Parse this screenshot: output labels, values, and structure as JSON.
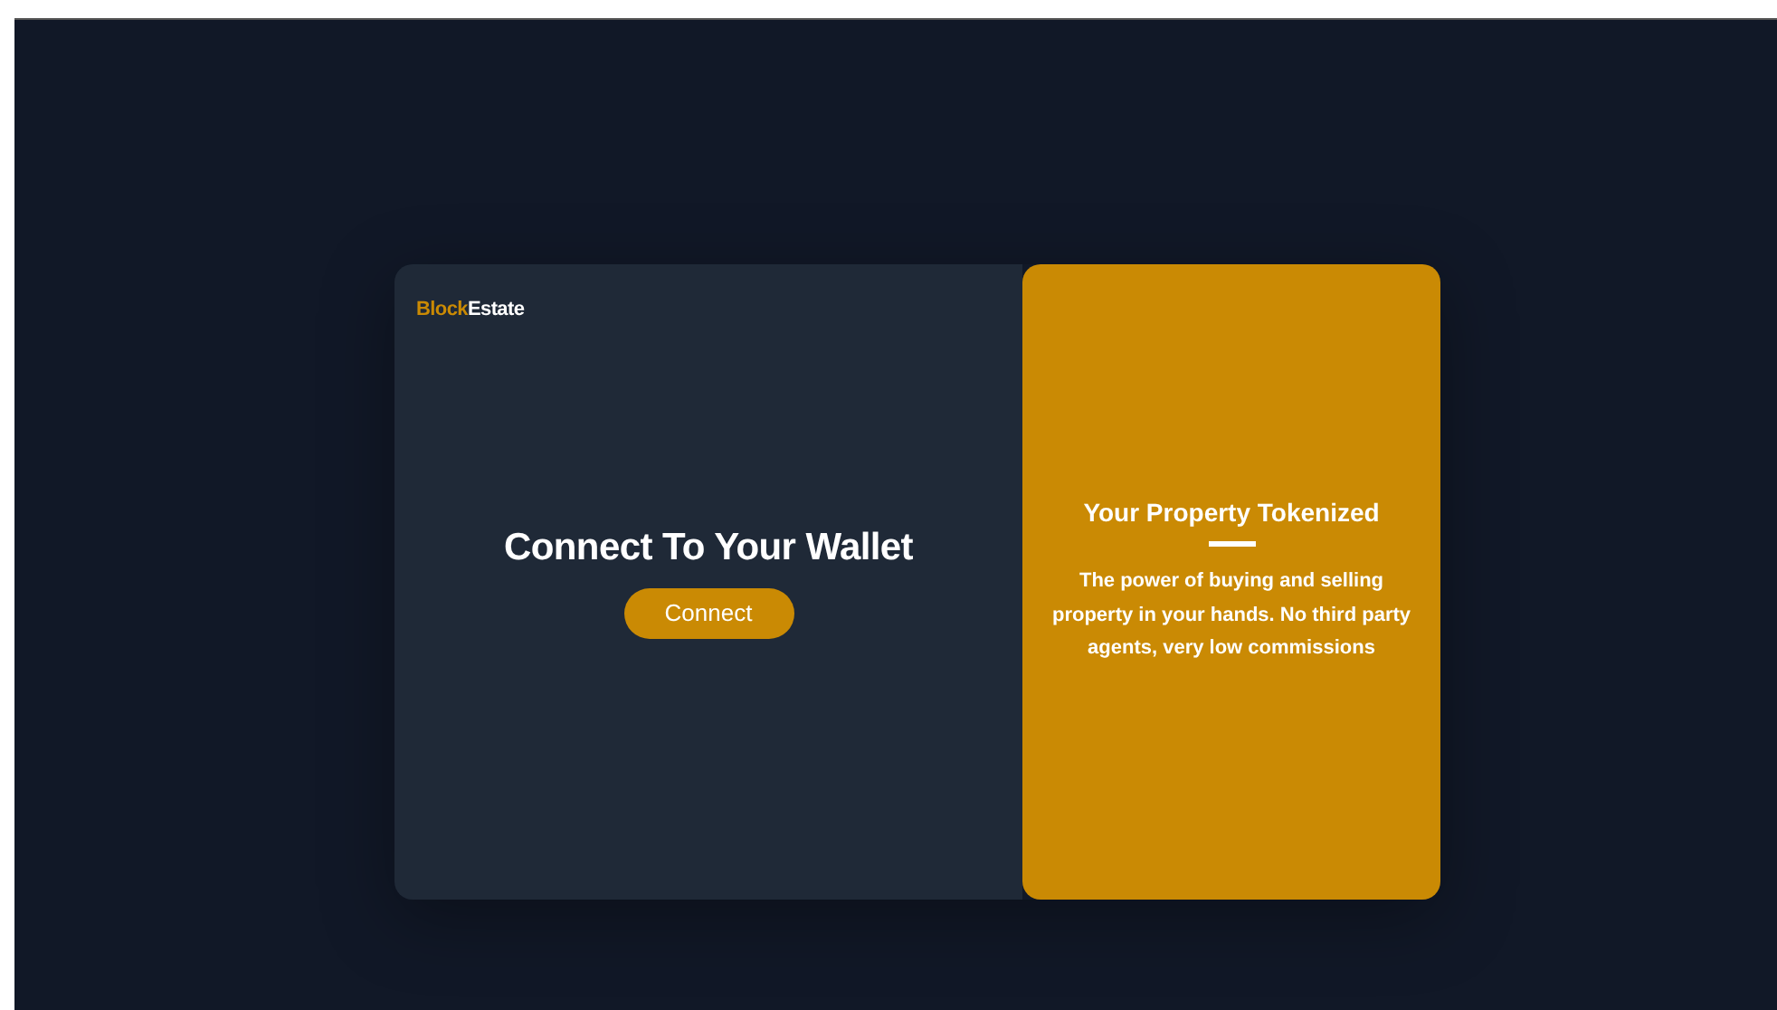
{
  "logo": {
    "accent": "Block",
    "rest": "Estate"
  },
  "connect_panel": {
    "heading": "Connect To Your Wallet",
    "button": "Connect"
  },
  "info_panel": {
    "heading": "Your Property Tokenized",
    "text": "The power of buying and selling property in your hands. No third party agents, very low commissions"
  }
}
